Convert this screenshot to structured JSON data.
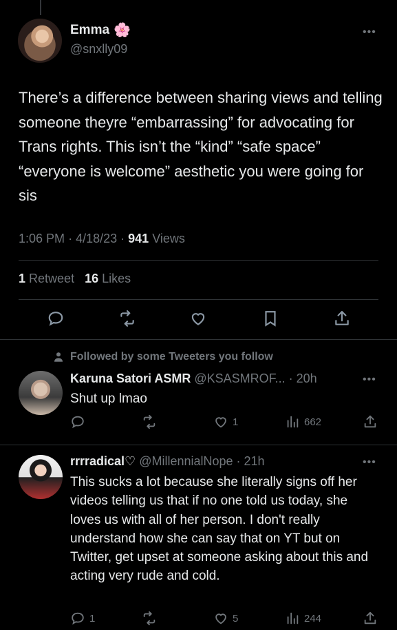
{
  "tweet": {
    "name": "Emma",
    "name_emoji": "🌸",
    "handle": "@snxlly09",
    "text": "There’s a difference between sharing views and telling someone theyre “embarrassing” for advocating for Trans rights. This isn’t the “kind” “safe space” “everyone is welcome” aesthetic you were going for sis",
    "time": "1:06 PM",
    "date": "4/18/23",
    "views_count": "941",
    "views_label": "Views",
    "retweets_count": "1",
    "retweets_label": "Retweet",
    "likes_count": "16",
    "likes_label": "Likes"
  },
  "icons": {
    "reply": "reply-icon",
    "retweet": "retweet-icon",
    "like": "heart-icon",
    "bookmark": "bookmark-icon",
    "share": "share-icon",
    "views": "views-icon",
    "more": "more-icon",
    "followed": "person-icon"
  },
  "replies": [
    {
      "context": "Followed by some Tweeters you follow",
      "name": "Karuna Satori ASMR",
      "handle": "@KSASMROF... · 20h",
      "text": "Shut up lmao",
      "retweets": "",
      "likes": "1",
      "views": "662"
    },
    {
      "name": "rrrradical♡",
      "handle": "@MillennialNope · 21h",
      "text": "This sucks a lot because she literally signs off her videos telling us that if no one told us today, she loves us with all of her person. I don't really understand how she can say that on YT but on Twitter, get upset at someone asking about this and acting very rude and cold.",
      "replies": "1",
      "likes": "5",
      "views": "244"
    }
  ],
  "colors": {
    "background": "#000000",
    "text": "#e7e9ea",
    "secondary": "#71767b",
    "divider": "#2f3336"
  }
}
